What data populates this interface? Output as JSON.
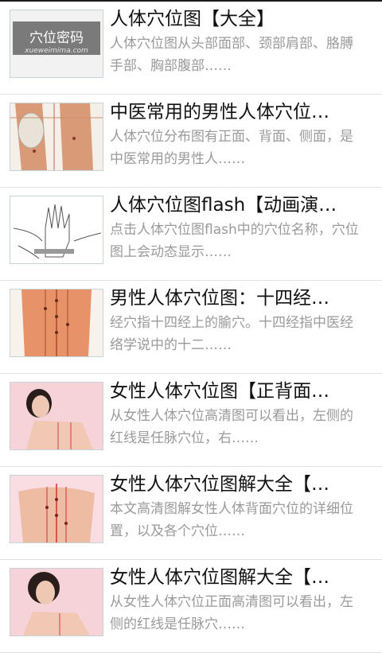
{
  "articles": [
    {
      "title": "人体穴位图【大全】",
      "description": "人体穴位图从头部面部、颈部肩部、胳膊手部、胸部腹部……",
      "thumb_icon": "logo-thumbnail",
      "thumb_logo_text": "穴位密码",
      "thumb_logo_url": "xueweimima.com"
    },
    {
      "title": "中医常用的男性人体穴位…",
      "description": "人体穴位分布图有正面、背面、侧面，是中医常用的男性人……",
      "thumb_icon": "male-hip-acupoint-thumbnail"
    },
    {
      "title": "人体穴位图flash【动画演…",
      "description": "点击人体穴位图flash中的穴位名称，穴位图上会动态显示……",
      "thumb_icon": "hand-sketch-thumbnail"
    },
    {
      "title": "男性人体穴位图：十四经…",
      "description": "经穴指十四经上的腧穴。十四经指中医经络学说中的十二……",
      "thumb_icon": "male-back-acupoint-thumbnail"
    },
    {
      "title": "女性人体穴位图【正背面…",
      "description": "从女性人体穴位高清图可以看出，左侧的红线是任脉穴位，右……",
      "thumb_icon": "female-front-thumbnail"
    },
    {
      "title": "女性人体穴位图解大全【…",
      "description": "本文高清图解女性人体背面穴位的详细位置，以及各个穴位……",
      "thumb_icon": "female-back-thumbnail"
    },
    {
      "title": "女性人体穴位图解大全【…",
      "description": "从女性人体穴位正面高清图可以看出，左侧的红线是任脉穴……",
      "thumb_icon": "female-portrait-thumbnail"
    }
  ]
}
